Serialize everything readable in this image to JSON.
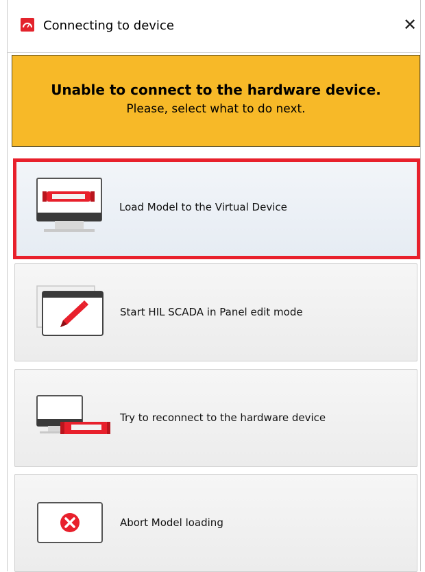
{
  "window": {
    "title": "Connecting to device",
    "icons": {
      "app": "typhoon-app-icon",
      "close": "close-icon"
    },
    "close_glyph": "✕"
  },
  "banner": {
    "title": "Unable to connect to the hardware device.",
    "subtitle": "Please, select what to do next.",
    "color": "#f7b928"
  },
  "options": [
    {
      "label": "Load Model to the Virtual Device",
      "icon": "virtual-device-monitor-icon",
      "selected": true
    },
    {
      "label": "Start HIL SCADA in Panel edit mode",
      "icon": "panel-edit-pencil-icon",
      "selected": false
    },
    {
      "label": "Try to reconnect to the hardware device",
      "icon": "reconnect-hardware-icon",
      "selected": false
    },
    {
      "label": "Abort Model loading",
      "icon": "abort-x-icon",
      "selected": false
    }
  ],
  "colors": {
    "accent": "#e8202c",
    "selection_border": "#e8202c"
  }
}
